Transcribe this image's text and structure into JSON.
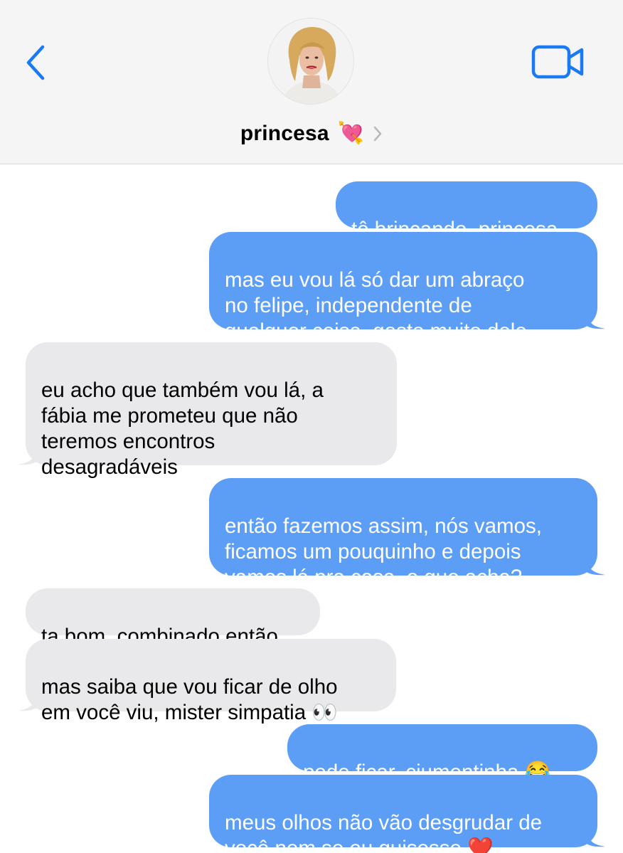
{
  "contact": {
    "name": "princesa",
    "emoji": "💘"
  },
  "icons": {
    "back": "chevron-left-icon",
    "video": "video-camera-icon",
    "contact_chevron": "chevron-right-icon"
  },
  "colors": {
    "accent": "#1b7af2",
    "sent_bubble": "#5c9ef5",
    "received_bubble": "#e9e9eb",
    "header_bg": "#f5f5f5"
  },
  "messages": [
    {
      "direction": "sent",
      "text": "tô brincando, princesa"
    },
    {
      "direction": "sent",
      "text": "mas eu vou lá só dar um abraço\nno felipe, independente de\nqualquer coisa, gosto muito dele"
    },
    {
      "direction": "received",
      "text": "eu acho que também vou lá, a\nfábia me prometeu que não\nteremos encontros\ndesagradáveis"
    },
    {
      "direction": "sent",
      "text": "então fazemos assim, nós vamos,\nficamos um pouquinho e depois\nvamos lá pra casa, o que acha?"
    },
    {
      "direction": "received",
      "text": "ta bom, combinado então"
    },
    {
      "direction": "received",
      "text": "mas saiba que vou ficar de olho\nem você viu, mister simpatia 👀"
    },
    {
      "direction": "sent",
      "text": "pode ficar, ciumentinha 😂"
    },
    {
      "direction": "sent",
      "text": "meus olhos não vão desgrudar de\nvocê nem se eu quisesse ❤️"
    }
  ]
}
